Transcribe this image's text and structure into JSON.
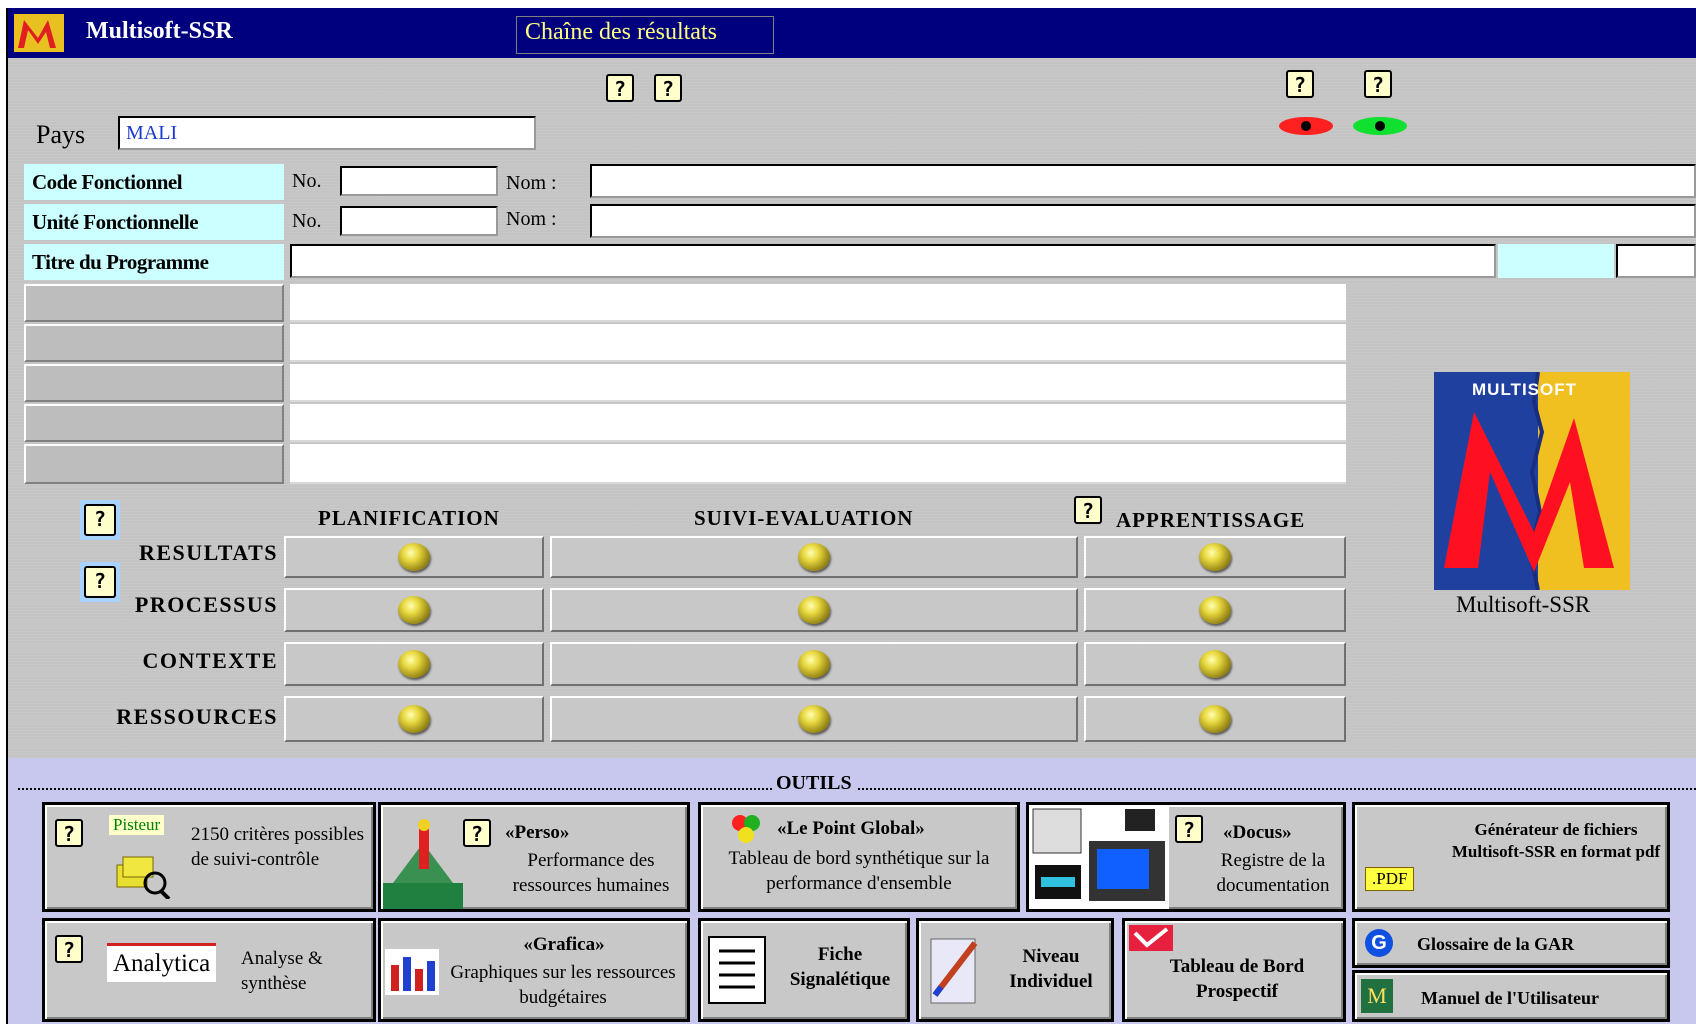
{
  "window": {
    "app_name": "Multisoft-SSR",
    "tab": "Chaîne des résultats"
  },
  "country": {
    "label": "Pays",
    "value": "MALI"
  },
  "fields": {
    "code_fonctionnel": {
      "label": "Code Fonctionnel",
      "no_label": "No.",
      "nom_label": "Nom :",
      "no_value": "",
      "nom_value": ""
    },
    "unite_fonctionnelle": {
      "label": "Unité Fonctionnelle",
      "no_label": "No.",
      "nom_label": "Nom :",
      "no_value": "",
      "nom_value": ""
    },
    "titre_programme": {
      "label": "Titre du Programme",
      "value": ""
    }
  },
  "matrix": {
    "columns": [
      "PLANIFICATION",
      "SUIVI-EVALUATION",
      "APPRENTISSAGE"
    ],
    "rows": [
      "RESULTATS",
      "PROCESSUS",
      "CONTEXTE",
      "RESSOURCES"
    ]
  },
  "logo": {
    "brand_text": "MULTISOFT",
    "caption": "Multisoft-SSR"
  },
  "outils": {
    "header": "OUTILS",
    "tools": {
      "pisteur": {
        "badge": "Pisteur",
        "text": "2150 critères possibles de suivi-contrôle"
      },
      "perso": {
        "title": "«Perso»",
        "text": "Performance des ressources humaines"
      },
      "point_global": {
        "title": "«Le Point Global»",
        "text": "Tableau de bord synthétique sur la performance  d'ensemble"
      },
      "docus": {
        "title": "«Docus»",
        "text": "Registre de la documentation"
      },
      "generateur": {
        "text": "Générateur de fichiers Multisoft-SSR en format pdf",
        "badge": ".PDF"
      },
      "analytica": {
        "logo": "Analytica",
        "text": "Analyse & synthèse"
      },
      "grafica": {
        "title": "«Grafica»",
        "text": "Graphiques sur les ressources budgétaires"
      },
      "fiche": {
        "text": "Fiche Signalétique"
      },
      "niveau": {
        "text": "Niveau Individuel"
      },
      "tableau_bord": {
        "text": "Tableau de Bord Prospectif"
      },
      "glossaire": {
        "text": "Glossaire de la GAR",
        "icon_letter": "G"
      },
      "manuel": {
        "text": "Manuel de l'Utilisateur",
        "icon_letter": "M"
      }
    }
  },
  "help_glyph": "?",
  "colors": {
    "titlebar": "#00007f",
    "tab_text": "#ffff80",
    "label_bg": "#ccffff",
    "tools_bg": "#c8c8ee"
  }
}
